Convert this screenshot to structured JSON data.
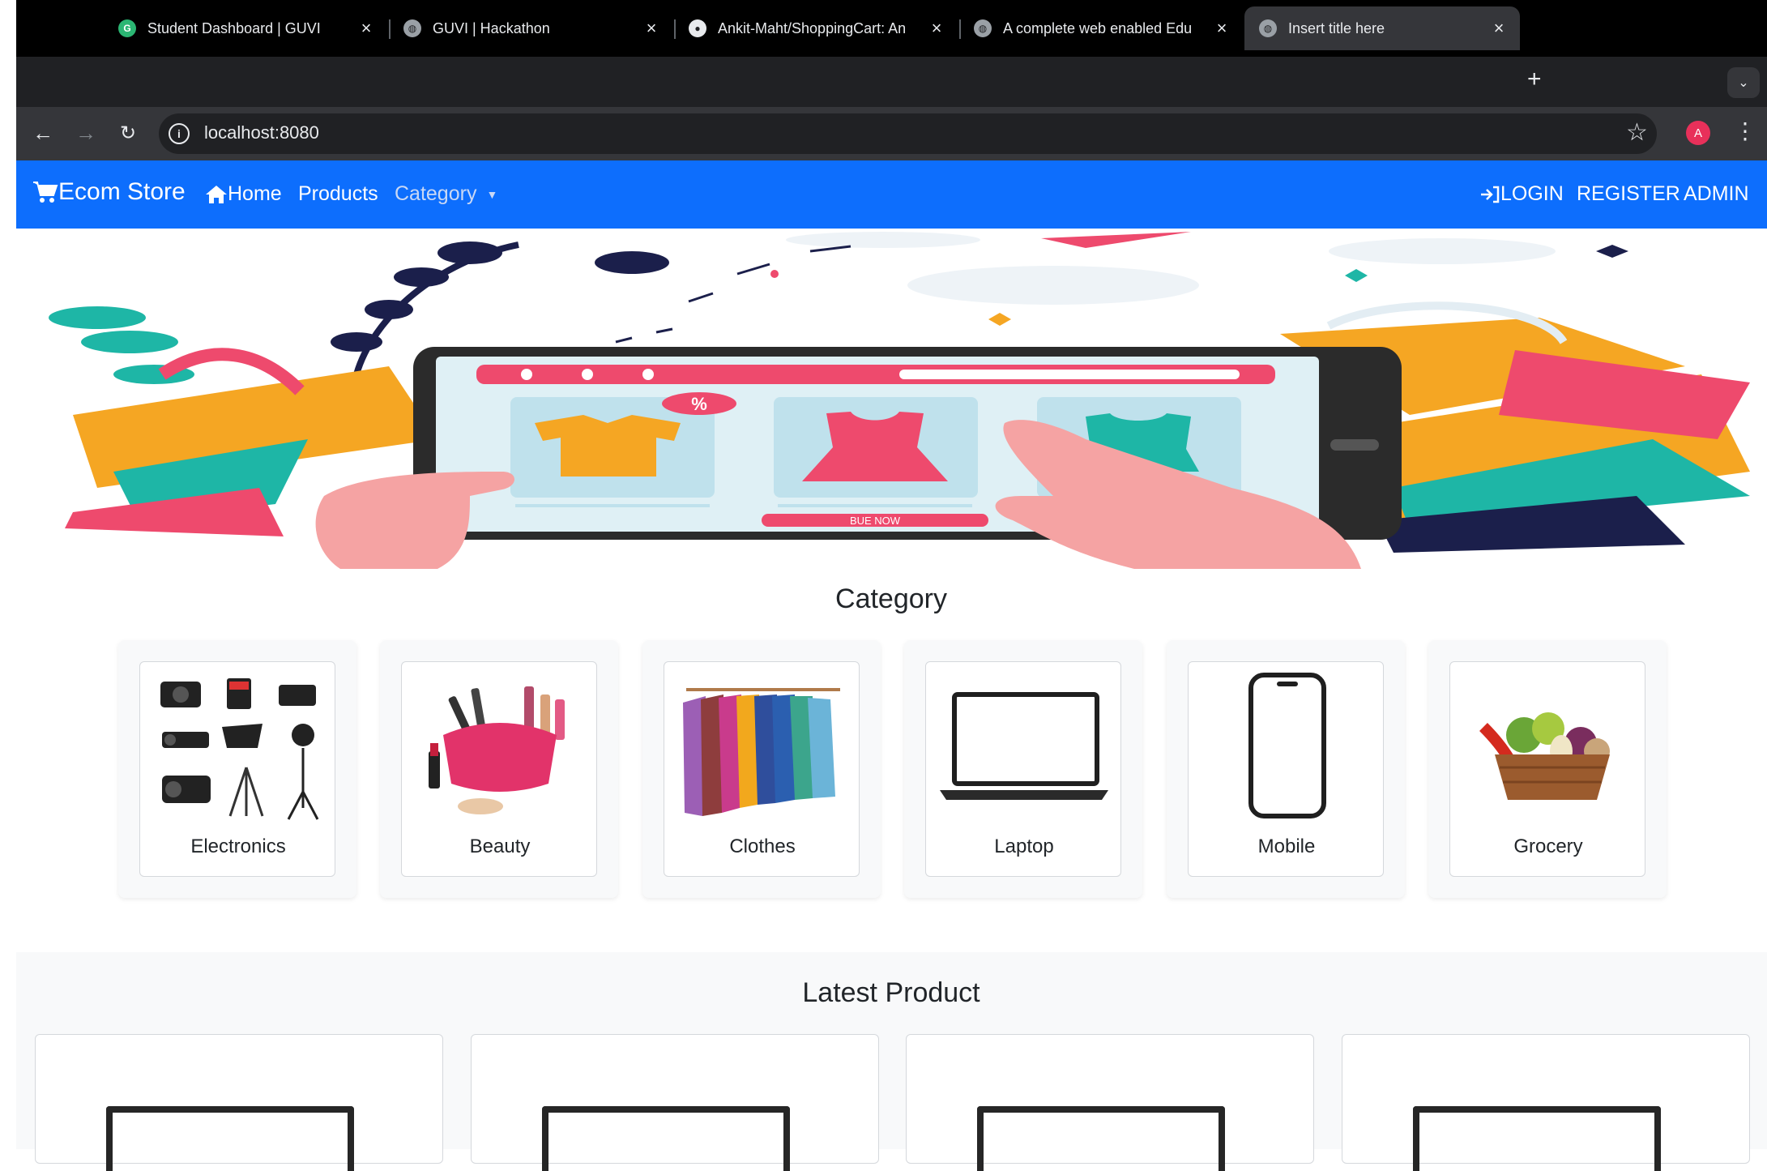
{
  "browser": {
    "tabs": [
      {
        "title": "Student Dashboard | GUVI",
        "active": false
      },
      {
        "title": "GUVI | Hackathon",
        "active": false
      },
      {
        "title": "Ankit-Maht/ShoppingCart: An",
        "active": false
      },
      {
        "title": "A complete web enabled Edu",
        "active": false
      },
      {
        "title": "Insert title here",
        "active": true
      }
    ],
    "new_tab": "+",
    "close": "×",
    "url": "localhost:8080",
    "profile_initial": "A"
  },
  "navbar": {
    "brand": "Ecom Store",
    "home": "Home",
    "products": "Products",
    "category": "Category",
    "login": "LOGIN",
    "register": "REGISTER",
    "admin": "ADMIN",
    "color": "#0d6efd"
  },
  "hero": {
    "discount_badge": "%",
    "buy_now": "BUE NOW"
  },
  "category": {
    "title": "Category",
    "items": [
      {
        "label": "Electronics"
      },
      {
        "label": "Beauty"
      },
      {
        "label": "Clothes"
      },
      {
        "label": "Laptop"
      },
      {
        "label": "Mobile"
      },
      {
        "label": "Grocery"
      }
    ]
  },
  "latest": {
    "title": "Latest Product",
    "count": 4
  }
}
